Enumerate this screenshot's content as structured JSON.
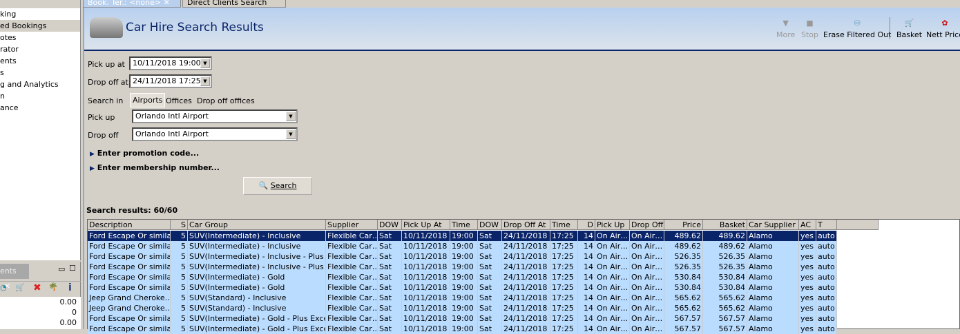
{
  "left_nav": {
    "items": [
      "king",
      "ed Bookings",
      "otes",
      "rator",
      "ents",
      "s",
      "g and Analytics",
      "n",
      "ance"
    ],
    "selected": 1
  },
  "left_bottom": {
    "tab": "ents",
    "values": [
      "0.00",
      "0",
      "0.00"
    ]
  },
  "tabs": [
    {
      "label": "Book. Ter.: <none>"
    },
    {
      "label": "Direct Clients Search"
    }
  ],
  "header": {
    "title": "Car Hire Search Results",
    "buttons": [
      "More",
      "Stop",
      "Erase Filtered Out",
      "Basket",
      "Nett Price"
    ]
  },
  "form": {
    "pickup_at_label": "Pick up at",
    "pickup_at": "10/11/2018 19:00",
    "dropoff_at_label": "Drop off at",
    "dropoff_at": "24/11/2018 17:25",
    "search_in_label": "Search in",
    "search_in_options": [
      "Airports",
      "Offices",
      "Drop off offices"
    ],
    "pickup_label": "Pick up",
    "pickup": "Orlando Intl Airport",
    "dropoff_label": "Drop off",
    "dropoff": "Orlando Intl Airport",
    "promo": "Enter promotion code...",
    "membership": "Enter membership number...",
    "search_button": "Search"
  },
  "results_label": "Search results: 60/60",
  "grid": {
    "columns": [
      "Description",
      "S",
      "Car Group",
      "Supplier",
      "DOW",
      "Pick Up At",
      "Time",
      "DOW",
      "Drop Off At",
      "Time",
      "D",
      "Pick Up",
      "Drop Off",
      "Price",
      "Basket",
      "Car Supplier",
      "AC",
      "T"
    ],
    "rows": [
      [
        "Ford Escape Or simila…",
        "5",
        "SUV(Intermediate) - Inclusive",
        "Flexible Car…",
        "Sat",
        "10/11/2018",
        "19:00",
        "Sat",
        "24/11/2018",
        "17:25",
        "14",
        "On Air…",
        "On Air…",
        "489.62",
        "489.62",
        "Alamo",
        "yes",
        "auto"
      ],
      [
        "Ford Escape Or simila…",
        "5",
        "SUV(Intermediate) - Inclusive",
        "Flexible Car…",
        "Sat",
        "10/11/2018",
        "19:00",
        "Sat",
        "24/11/2018",
        "17:25",
        "14",
        "On Air…",
        "On Air…",
        "489.62",
        "489.62",
        "Alamo",
        "yes",
        "auto"
      ],
      [
        "Ford Escape Or simila…",
        "5",
        "SUV(Intermediate) - Inclusive - Plus E…",
        "Flexible Car…",
        "Sat",
        "10/11/2018",
        "19:00",
        "Sat",
        "24/11/2018",
        "17:25",
        "14",
        "On Air…",
        "On Air…",
        "526.35",
        "526.35",
        "Alamo",
        "yes",
        "auto"
      ],
      [
        "Ford Escape Or simila…",
        "5",
        "SUV(Intermediate) - Inclusive - Plus E…",
        "Flexible Car…",
        "Sat",
        "10/11/2018",
        "19:00",
        "Sat",
        "24/11/2018",
        "17:25",
        "14",
        "On Air…",
        "On Air…",
        "526.35",
        "526.35",
        "Alamo",
        "yes",
        "auto"
      ],
      [
        "Ford Escape Or simila…",
        "5",
        "SUV(Intermediate) - Gold",
        "Flexible Car…",
        "Sat",
        "10/11/2018",
        "19:00",
        "Sat",
        "24/11/2018",
        "17:25",
        "14",
        "On Air…",
        "On Air…",
        "530.84",
        "530.84",
        "Alamo",
        "yes",
        "auto"
      ],
      [
        "Ford Escape Or simila…",
        "5",
        "SUV(Intermediate) - Gold",
        "Flexible Car…",
        "Sat",
        "10/11/2018",
        "19:00",
        "Sat",
        "24/11/2018",
        "17:25",
        "14",
        "On Air…",
        "On Air…",
        "530.84",
        "530.84",
        "Alamo",
        "yes",
        "auto"
      ],
      [
        "Jeep Grand Cheroke…",
        "5",
        "SUV(Standard) - Inclusive",
        "Flexible Car…",
        "Sat",
        "10/11/2018",
        "19:00",
        "Sat",
        "24/11/2018",
        "17:25",
        "14",
        "On Air…",
        "On Air…",
        "565.62",
        "565.62",
        "Alamo",
        "yes",
        "auto"
      ],
      [
        "Jeep Grand Cheroke…",
        "5",
        "SUV(Standard) - Inclusive",
        "Flexible Car…",
        "Sat",
        "10/11/2018",
        "19:00",
        "Sat",
        "24/11/2018",
        "17:25",
        "14",
        "On Air…",
        "On Air…",
        "565.62",
        "565.62",
        "Alamo",
        "yes",
        "auto"
      ],
      [
        "Ford Escape Or simila…",
        "5",
        "SUV(Intermediate) - Gold - Plus Exces…",
        "Flexible Car…",
        "Sat",
        "10/11/2018",
        "19:00",
        "Sat",
        "24/11/2018",
        "17:25",
        "14",
        "On Air…",
        "On Air…",
        "567.57",
        "567.57",
        "Alamo",
        "yes",
        "auto"
      ],
      [
        "Ford Escape Or simila…",
        "5",
        "SUV(Intermediate) - Gold - Plus Exces…",
        "Flexible Car…",
        "Sat",
        "10/11/2018",
        "19:00",
        "Sat",
        "24/11/2018",
        "17:25",
        "14",
        "On Air…",
        "On Air…",
        "567.57",
        "567.57",
        "Alamo",
        "yes",
        "auto"
      ]
    ]
  }
}
